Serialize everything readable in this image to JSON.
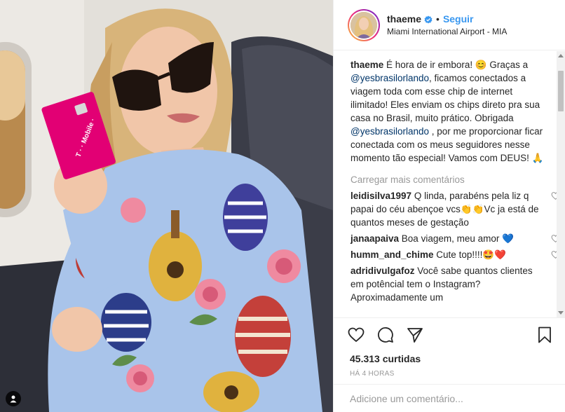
{
  "post": {
    "username": "thaeme",
    "follow_label": "Seguir",
    "separator": "•",
    "location": "Miami International Airport - MIA"
  },
  "caption": {
    "username": "thaeme",
    "part1": " É hora de ir embora! 😊 Graças a ",
    "mention1": "@yesbrasilorlando",
    "part2": ", ficamos conectados a viagem toda com esse chip de internet ilimitado! Eles enviam os chips direto pra sua casa no Brasil, muito prático. Obrigada ",
    "mention2": "@yesbrasilorlando",
    "part3": " , por me proporcionar ficar conectada com os meus seguidores nesse momento tão especial! Vamos com DEUS! 🙏"
  },
  "load_more_label": "Carregar mais comentários",
  "comments": [
    {
      "username": "leidisilva1997",
      "text": " Q linda, parabéns pela liz q papai do céu abençoe vcs👏👏Vc ja está de quantos meses de gestação"
    },
    {
      "username": "janaapaiva",
      "text": " Boa viagem, meu amor 💙"
    },
    {
      "username": "humm_and_chime",
      "text": " Cute top!!!!🤩❤️"
    },
    {
      "username": "adridivulgafoz",
      "text": " Você sabe quantos clientes em potêncial tem o Instagram? Aproximadamente um"
    }
  ],
  "likes_label": "45.313 curtidas",
  "timestamp": "HÁ 4 HORAS",
  "add_comment_placeholder": "Adicione um comentário...",
  "photo": {
    "sim_card_text": "T · · Mobile ·"
  },
  "icons": {
    "verified": "verified-badge-icon",
    "like": "heart-icon",
    "comment": "comment-bubble-icon",
    "share": "share-icon",
    "save": "bookmark-icon",
    "photo_tag": "user-tag-icon"
  },
  "colors": {
    "link_blue": "#3897f0",
    "mention_blue": "#003569",
    "muted": "#999999",
    "text": "#262626",
    "border": "#efefef"
  }
}
